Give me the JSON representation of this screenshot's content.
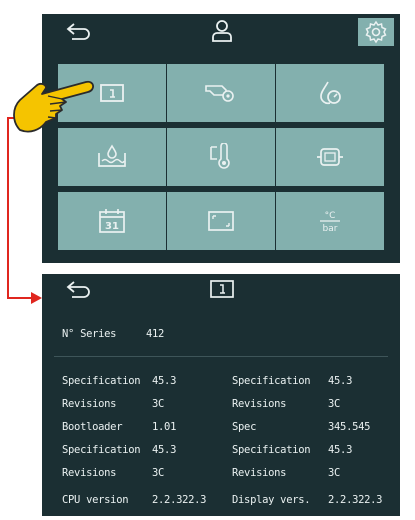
{
  "top_screen": {
    "icons": [
      "back-arrow-icon",
      "user-icon",
      "gear-icon"
    ],
    "tiles": [
      "info-icon",
      "pump-gear-icon",
      "water-drop-gauge-icon",
      "water-level-icon",
      "thermometer-icon",
      "device-icon",
      "calendar-icon",
      "screen-frame-icon",
      "units-icon"
    ],
    "calendar_label": "31",
    "units_label_top": "°C",
    "units_label_bottom": "bar"
  },
  "info_screen": {
    "icons": [
      "back-arrow-icon",
      "info-icon"
    ],
    "serial": {
      "label": "N° Series",
      "value": "412"
    },
    "rows_left": [
      {
        "label": "Specification",
        "value": "45.3"
      },
      {
        "label": "Revisions",
        "value": "3C"
      },
      {
        "label": "Bootloader",
        "value": "1.01"
      },
      {
        "label": "Specification",
        "value": "45.3"
      },
      {
        "label": "Revisions",
        "value": "3C"
      },
      {
        "label": "CPU version",
        "value": "2.2.322.3"
      }
    ],
    "rows_right": [
      {
        "label": "Specification",
        "value": "45.3"
      },
      {
        "label": "Revisions",
        "value": "3C"
      },
      {
        "label": "Spec",
        "value": "345.545"
      },
      {
        "label": "Specification",
        "value": "45.3"
      },
      {
        "label": "Revisions",
        "value": "3C"
      },
      {
        "label": "Display vers.",
        "value": "2.2.322.3"
      }
    ]
  },
  "colors": {
    "panel": "#1b2f33",
    "tile": "#83b0ae",
    "accent_red": "#e0261f",
    "hand_yellow": "#f5c400",
    "text": "#eaf1f1"
  }
}
